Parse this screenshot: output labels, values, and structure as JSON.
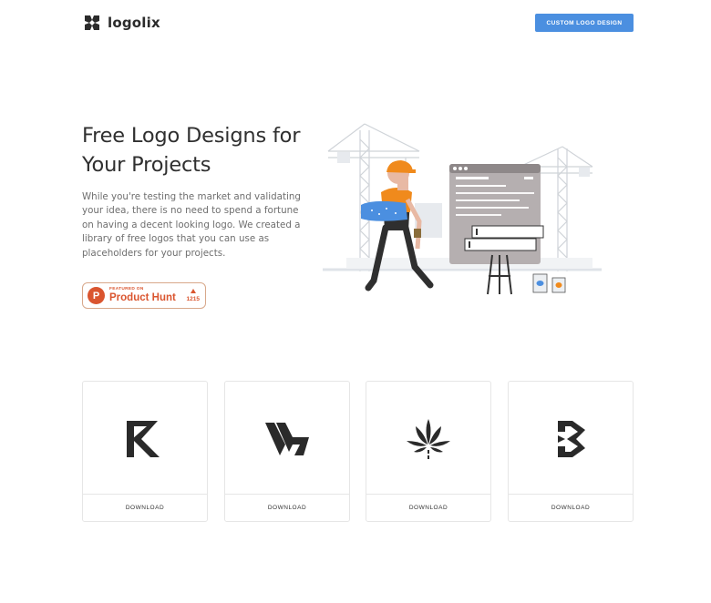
{
  "header": {
    "brand": "logolix",
    "cta_label": "CUSTOM LOGO DESIGN"
  },
  "hero": {
    "title": "Free Logo Designs for Your Projects",
    "description": "While you're testing the market and validating your idea, there is no need to spend a fortune on having a decent looking logo. We created a library of free logos that you can use as placeholders for your projects."
  },
  "product_hunt": {
    "featured_label": "FEATURED ON",
    "name": "Product Hunt",
    "letter": "P",
    "votes": "1215"
  },
  "logos": [
    {
      "icon": "r-letter-logo-icon",
      "download_label": "DOWNLOAD"
    },
    {
      "icon": "chevron-stripes-logo-icon",
      "download_label": "DOWNLOAD"
    },
    {
      "icon": "leaf-burst-logo-icon",
      "download_label": "DOWNLOAD"
    },
    {
      "icon": "b-hexagon-logo-icon",
      "download_label": "DOWNLOAD"
    }
  ],
  "colors": {
    "accent": "#4b8fe0",
    "product_hunt": "#da552f",
    "illustration_orange": "#f08a1c",
    "text_dark": "#303030",
    "text_muted": "#6f6f6f"
  }
}
